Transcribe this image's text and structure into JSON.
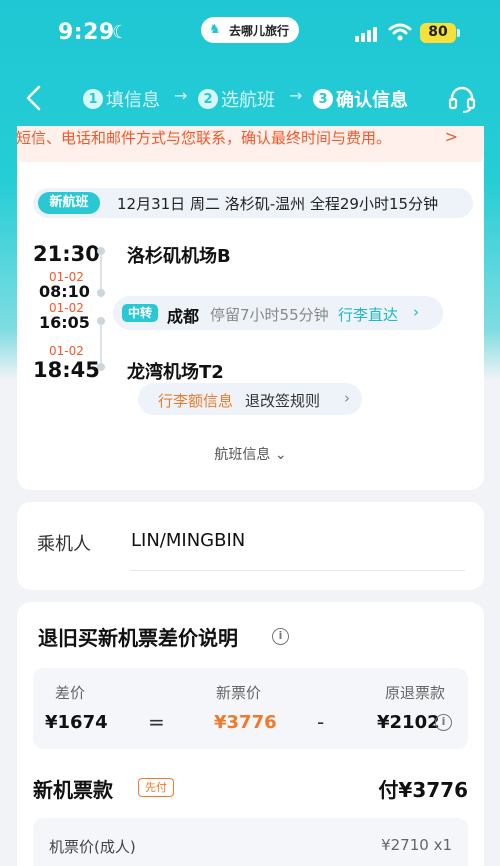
{
  "status": {
    "time": "9:29",
    "brand": "去哪儿旅行",
    "battery": "80"
  },
  "nav": {
    "steps": [
      {
        "num": "1",
        "label": "填信息"
      },
      {
        "num": "2",
        "label": "选航班"
      },
      {
        "num": "3",
        "label": "确认信息"
      }
    ],
    "arrow": "→"
  },
  "notice": {
    "text": "通过短信、电话和邮件方式与您联系，确认最终时间与费用。",
    "chevron": ">"
  },
  "flight": {
    "tag": "新航班",
    "summary": "12月31日 周二 洛杉矶-温州 全程29小时15分钟",
    "departure": {
      "time": "21:30",
      "airport": "洛杉矶机场B"
    },
    "transfer": {
      "arrive_date": "01-02",
      "arrive_time": "08:10",
      "depart_date": "01-02",
      "depart_time": "16:05",
      "tag": "中转",
      "city": "成都",
      "stay": "停留7小时55分钟",
      "luggage": "行李直达"
    },
    "arrival": {
      "date": "01-02",
      "time": "18:45",
      "airport": "龙湾机场T2"
    },
    "rules": {
      "luggage": "行李额信息",
      "refund": "退改签规则"
    },
    "info_link": "航班信息"
  },
  "passenger": {
    "label": "乘机人",
    "name": "LIN/MINGBIN"
  },
  "diff": {
    "title": "退旧买新机票差价说明",
    "diff_label": "差价",
    "diff_value": "¥1674",
    "equals": "=",
    "new_label": "新票价",
    "new_value": "¥3776",
    "minus": "-",
    "old_label": "原退票款",
    "old_value": "¥2102"
  },
  "payment": {
    "title": "新机票款",
    "prepay_tag": "先付",
    "total": "付¥3776",
    "fare_label": "机票价(成人)",
    "fare_value": "¥2710 x1"
  },
  "colors": {
    "brand": "#1fc7d4",
    "accent_orange": "#f05a2c",
    "price_orange": "#f07a2c"
  }
}
